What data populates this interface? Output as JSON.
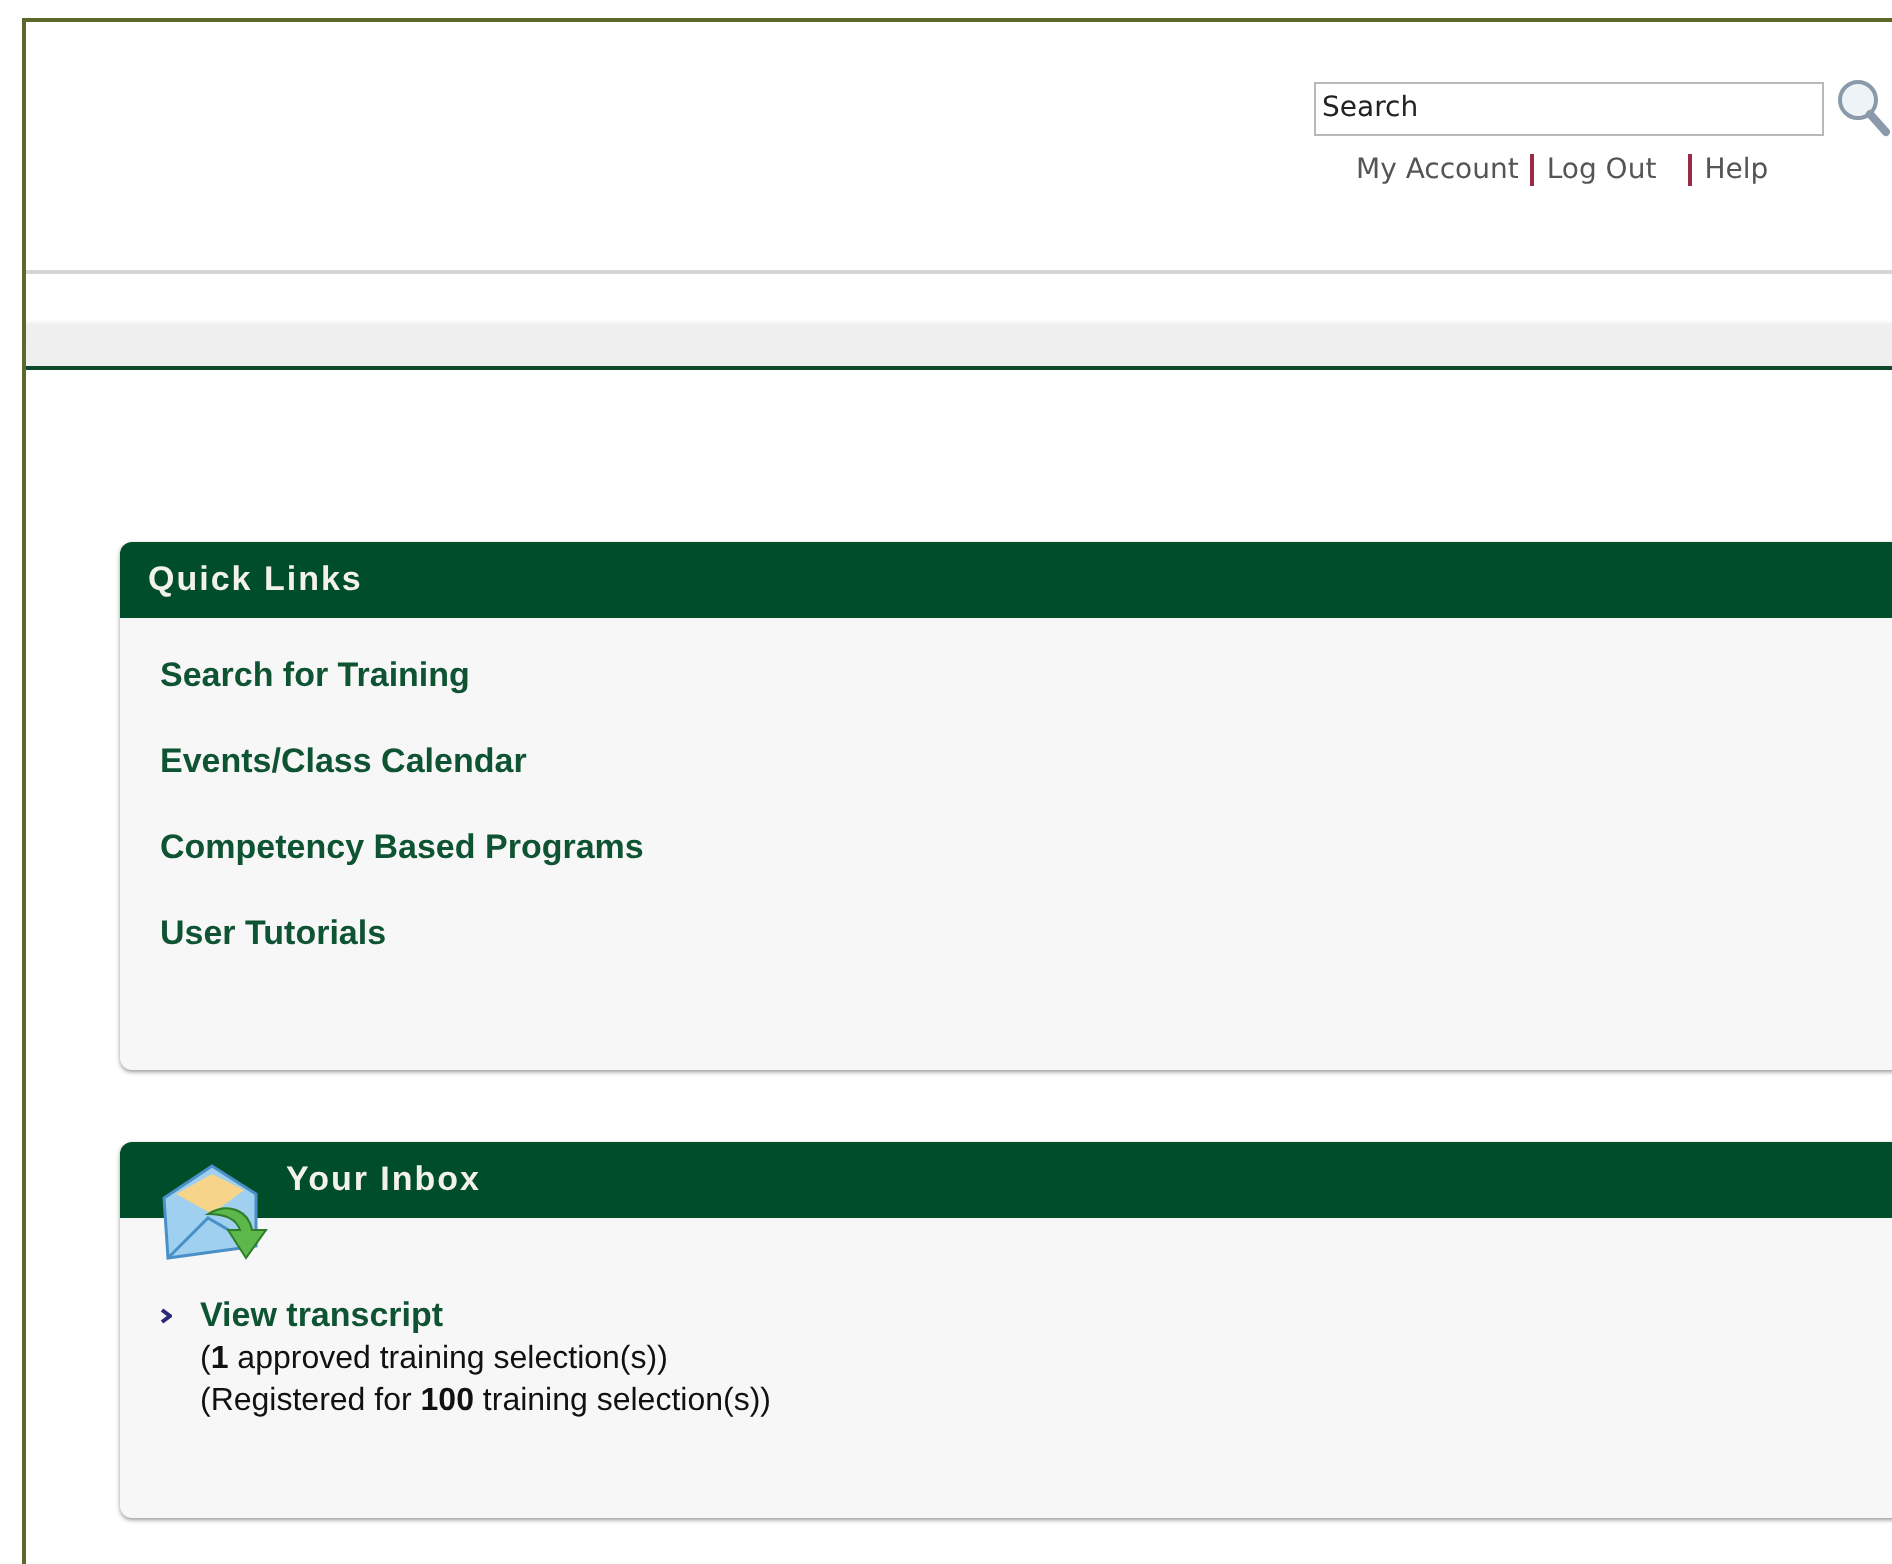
{
  "search": {
    "placeholder": "Search"
  },
  "header_links": [
    {
      "label": "My Account"
    },
    {
      "label": "Log Out"
    },
    {
      "label": "Help"
    }
  ],
  "quick_links": {
    "title": "Quick Links",
    "items": [
      "Search for Training",
      "Events/Class Calendar",
      "Competency Based Programs",
      "User Tutorials"
    ]
  },
  "inbox": {
    "title": "Your Inbox",
    "link": "View transcript",
    "lines": [
      "(**1** approved training selection(s))",
      "(Registered for **100** training selection(s))"
    ]
  }
}
